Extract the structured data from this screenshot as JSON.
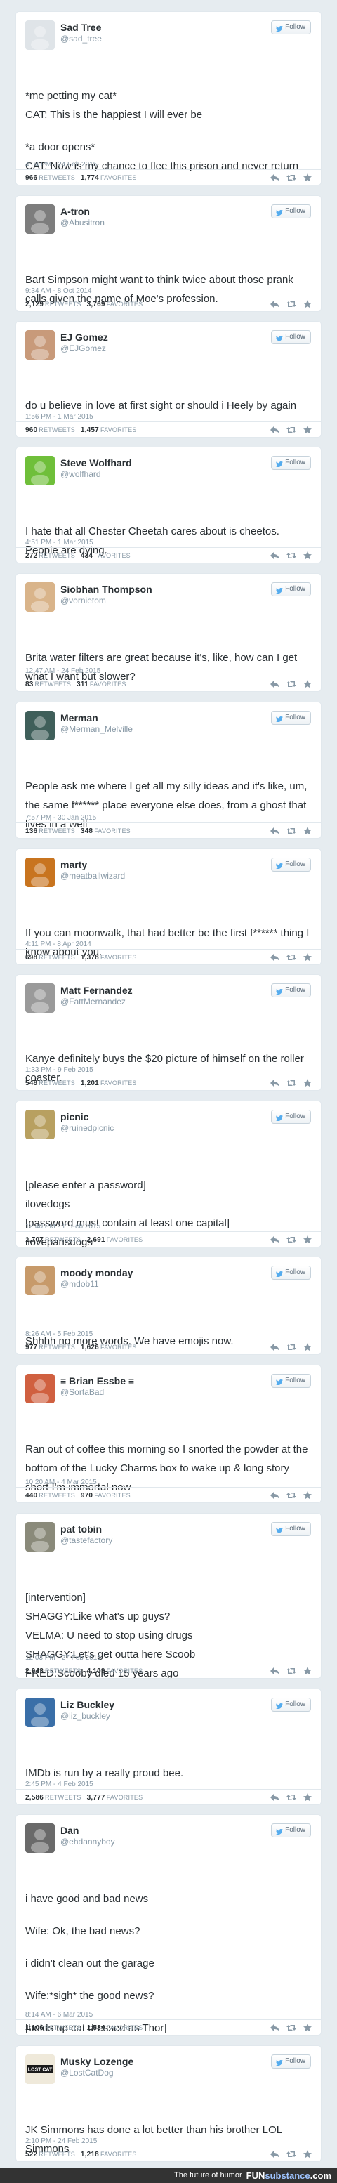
{
  "follow_label": "Follow",
  "tweets": [
    {
      "name": "Sad Tree",
      "handle": "@sad_tree",
      "avatar_color": "#dfe4e8",
      "lines": [
        "*me petting my cat*",
        "CAT: This is the happiest I will ever be",
        "",
        "*a door opens*",
        "CAT: Now is my chance to flee this prison and never return"
      ],
      "time": "4:04 PM - 24 Feb 2015",
      "retweets": "966",
      "favorites": "1,774"
    },
    {
      "name": "A-tron",
      "handle": "@Abusitron",
      "avatar_color": "#7d7d7d",
      "lines": [
        "Bart Simpson might want to think twice about those prank calls given the name of Moe's profession."
      ],
      "time": "9:34 AM - 8 Oct 2014",
      "retweets": "2,129",
      "favorites": "3,769"
    },
    {
      "name": "EJ Gomez",
      "handle": "@EJGomez",
      "avatar_color": "#c89a7a",
      "lines": [
        "do u believe in love at first sight or should i Heely by again"
      ],
      "time": "1:56 PM - 1 Mar 2015",
      "retweets": "960",
      "favorites": "1,457"
    },
    {
      "name": "Steve Wolfhard",
      "handle": "@wolfhard",
      "avatar_color": "#6fbf3a",
      "lines": [
        "I hate that all Chester Cheetah cares about is cheetos. People are dying."
      ],
      "time": "4:51 PM - 1 Mar 2015",
      "retweets": "272",
      "favorites": "434"
    },
    {
      "name": "Siobhan Thompson",
      "handle": "@vornietom",
      "avatar_color": "#d9b48a",
      "lines": [
        "Brita water filters are great because it's, like, how can I get what I want but slower?"
      ],
      "time": "12:47 AM - 24 Feb 2015",
      "retweets": "83",
      "favorites": "311"
    },
    {
      "name": "Merman",
      "handle": "@Merman_Melville",
      "avatar_color": "#3f5f5a",
      "lines": [
        "People ask me where I get all my silly ideas and it's like, um, the same f****** place everyone else does, from a ghost that lives in a well"
      ],
      "time": "7:57 PM - 30 Jan 2015",
      "retweets": "136",
      "favorites": "348"
    },
    {
      "name": "marty",
      "handle": "@meatballwizard",
      "avatar_color": "#c8741f",
      "lines": [
        "If you can moonwalk, that had better be the first f****** thing I know about you."
      ],
      "time": "4:11 PM - 8 Apr 2014",
      "retweets": "698",
      "favorites": "1,378"
    },
    {
      "name": "Matt Fernandez",
      "handle": "@FattMernandez",
      "avatar_color": "#9a9a9a",
      "lines": [
        "Kanye definitely buys the $20 picture of himself on the roller coaster."
      ],
      "time": "1:33 PM - 9 Feb 2015",
      "retweets": "548",
      "favorites": "1,201"
    },
    {
      "name": "picnic",
      "handle": "@ruinedpicnic",
      "avatar_color": "#b8a060",
      "lines": [
        "[please enter a password]",
        "ilovedogs",
        "[password must contain at least one capital]",
        "iloveparisdogs"
      ],
      "time": "12:40 PM - 11 Feb 2015",
      "retweets": "1,707",
      "favorites": "2,691"
    },
    {
      "name": "moody monday",
      "handle": "@mdob11",
      "avatar_color": "#c79a6a",
      "lines": [
        "Shhhh no more words. We have emojis now."
      ],
      "time": "8:26 AM - 5 Feb 2015",
      "retweets": "977",
      "favorites": "1,626"
    },
    {
      "name": "≡ Brian Essbe ≡",
      "handle": "@SortaBad",
      "avatar_color": "#d06040",
      "lines": [
        "Ran out of coffee this morning so I snorted the powder at the bottom of the Lucky Charms box to wake up & long story short I'm immortal now"
      ],
      "time": "10:20 AM - 4 Mar 2015",
      "retweets": "440",
      "favorites": "970"
    },
    {
      "name": "pat tobin",
      "handle": "@tastefactory",
      "avatar_color": "#8a8a7a",
      "lines": [
        "[intervention]",
        "SHAGGY:Like what's up guys?",
        "VELMA: U need to stop using drugs",
        "SHAGGY:Let's get outta here Scoob",
        "FRED:Scooby died 15 years ago"
      ],
      "time": "12:03 PM - 27 Feb 2015",
      "retweets": "2,043",
      "favorites": "4,109"
    },
    {
      "name": "Liz Buckley",
      "handle": "@liz_buckley",
      "avatar_color": "#3a6fa8",
      "lines": [
        "IMDb is run by a really proud bee."
      ],
      "time": "2:45 PM - 4 Feb 2015",
      "retweets": "2,586",
      "favorites": "3,777"
    },
    {
      "name": "Dan",
      "handle": "@ehdannyboy",
      "avatar_color": "#6a6a6a",
      "lines": [
        "i have good and bad news",
        "",
        "Wife: Ok, the bad news?",
        "",
        "i didn't clean out the garage",
        "",
        "Wife:*sigh* the good news?",
        "",
        "[holds up cat dressed as Thor]"
      ],
      "time": "8:14 AM - 6 Mar 2015",
      "retweets": "1,106",
      "favorites": "1,534"
    },
    {
      "name": "Musky Lozenge",
      "handle": "@LostCatDog",
      "avatar_color": "#e9e4d8",
      "lines": [
        "JK Simmons has done a lot better than his brother LOL Simmons"
      ],
      "time": "2:10 PM - 24 Feb 2015",
      "retweets": "522",
      "favorites": "1,218"
    }
  ],
  "footer": {
    "tagline": "The future of humor",
    "logo_fun": "FUN",
    "logo_sub": "substance",
    "logo_com": ".com"
  },
  "stat_labels": {
    "retweets": "RETWEETS",
    "favorites": "FAVORITES"
  },
  "avatar_badge": "LOST CAT"
}
